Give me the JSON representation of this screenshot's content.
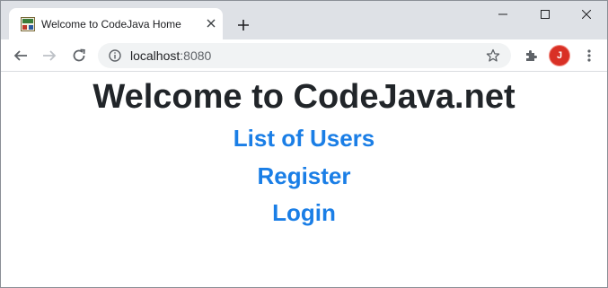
{
  "browser": {
    "tab": {
      "title": "Welcome to CodeJava Home",
      "favicon": "codejava-favicon"
    },
    "new_tab_icon": "plus-icon",
    "window_controls": [
      "minimize-icon",
      "maximize-icon",
      "close-icon"
    ],
    "toolbar": {
      "url_host": "localhost",
      "url_port": ":8080",
      "profile_initial": "J",
      "icons": [
        "back-arrow-icon",
        "forward-arrow-icon",
        "reload-icon",
        "info-icon",
        "star-icon",
        "puzzle-icon",
        "kebab-menu-icon"
      ]
    }
  },
  "page": {
    "title": "Welcome to CodeJava.net",
    "links": {
      "users": "List of Users",
      "register": "Register",
      "login": "Login"
    }
  },
  "colors": {
    "link": "#1a7ee6",
    "heading": "#212529",
    "tabstrip": "#dee1e6",
    "avatar": "#d93025"
  }
}
